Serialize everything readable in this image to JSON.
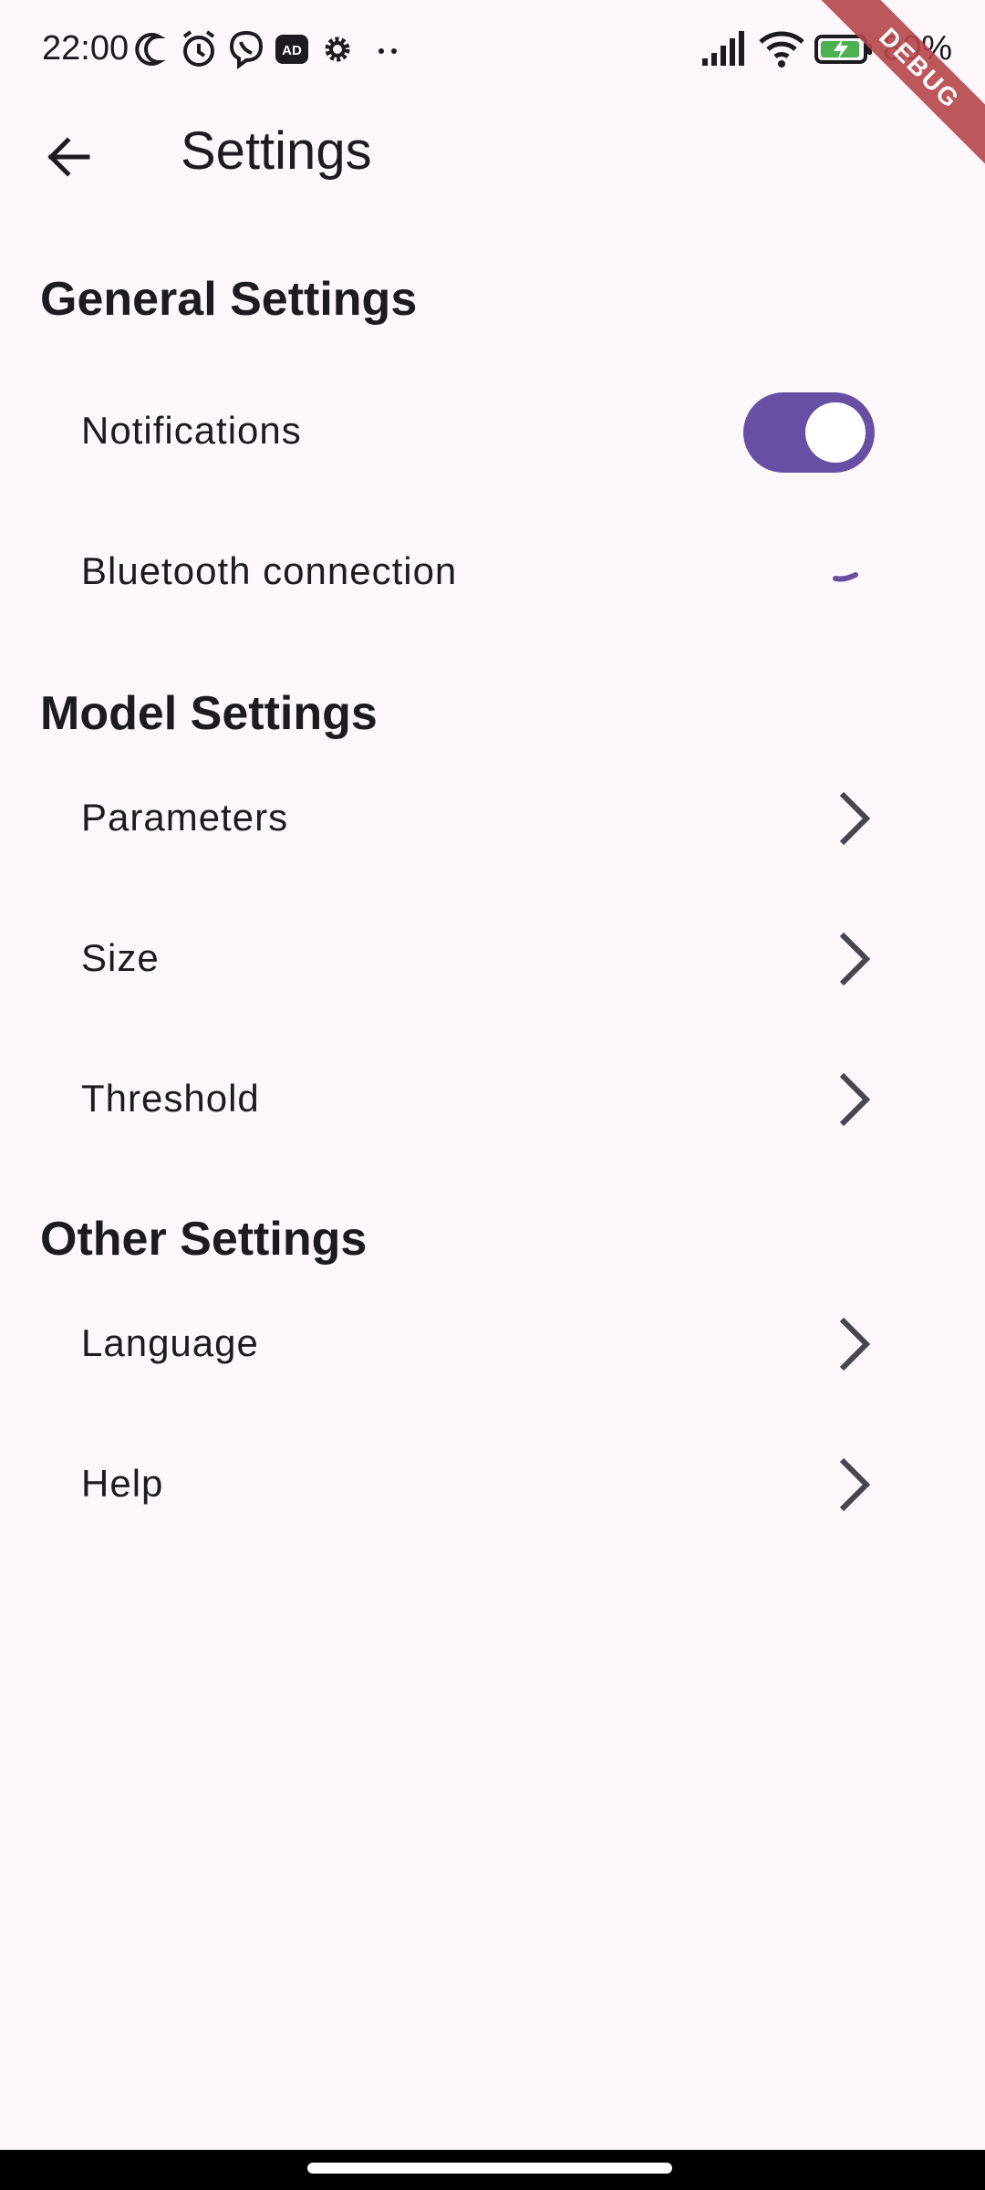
{
  "status_bar": {
    "time": "22:00",
    "left_icons": [
      "moon-icon",
      "alarm-icon",
      "viber-icon",
      "ad-blocker-icon",
      "gear-icon",
      "more-dots-icon"
    ],
    "ad_blocker_label": "AD",
    "right_icons": [
      "signal-icon",
      "wifi-icon",
      "battery-charging-icon"
    ],
    "battery": "80%",
    "debug_banner": "DEBUG"
  },
  "app_bar": {
    "title": "Settings",
    "back_icon": "arrow-back-icon"
  },
  "sections": {
    "general": {
      "title": "General Settings",
      "notifications": {
        "label": "Notifications",
        "enabled": true
      },
      "bluetooth": {
        "label": "Bluetooth connection",
        "loading": true
      }
    },
    "model": {
      "title": "Model Settings",
      "items": [
        "Parameters",
        "Size",
        "Threshold"
      ]
    },
    "other": {
      "title": "Other Settings",
      "items": [
        "Language",
        "Help"
      ]
    }
  },
  "colors": {
    "background": "#fdf7fb",
    "accent": "#6750a4",
    "text": "#1d1b20",
    "debug": "#b5464a"
  }
}
